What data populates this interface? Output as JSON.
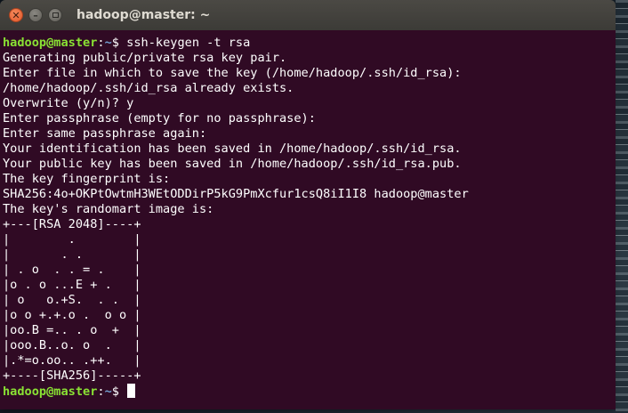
{
  "window": {
    "title": "hadoop@master: ~"
  },
  "terminal": {
    "prompt_user": "hadoop@master",
    "prompt_sep": ":",
    "prompt_path": "~",
    "prompt_symbol": "$ ",
    "command": "ssh-keygen -t rsa",
    "output": [
      "Generating public/private rsa key pair.",
      "Enter file in which to save the key (/home/hadoop/.ssh/id_rsa):",
      "/home/hadoop/.ssh/id_rsa already exists.",
      "Overwrite (y/n)? y",
      "Enter passphrase (empty for no passphrase):",
      "Enter same passphrase again:",
      "Your identification has been saved in /home/hadoop/.ssh/id_rsa.",
      "Your public key has been saved in /home/hadoop/.ssh/id_rsa.pub.",
      "The key fingerprint is:",
      "SHA256:4o+OKPtOwtmH3WEtODDirP5kG9PmXcfur1csQ8iI1I8 hadoop@master",
      "The key's randomart image is:",
      "+---[RSA 2048]----+",
      "|        .        |",
      "|       . .       |",
      "| . o  . . = .    |",
      "|o . o ...E + .   |",
      "| o   o.+S.  . .  |",
      "|o o +.+.o .  o o |",
      "|oo.B =.. . o  +  |",
      "|ooo.B..o. o  .   |",
      "|.*=o.oo.. .++.   |",
      "+----[SHA256]-----+"
    ]
  }
}
